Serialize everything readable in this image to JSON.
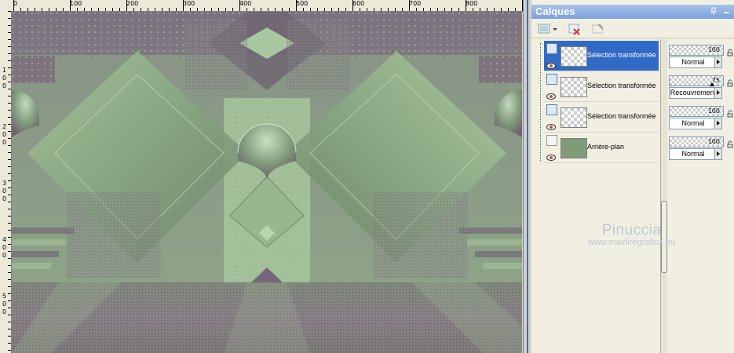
{
  "ruler": {
    "top_labels": [
      "0",
      "100",
      "200",
      "300",
      "400",
      "500",
      "600",
      "700",
      "800"
    ],
    "left_labels": [
      "1",
      "0",
      "0",
      "2",
      "0",
      "0",
      "3",
      "0",
      "0",
      "4",
      "0",
      "0",
      "5",
      "0",
      "0"
    ]
  },
  "panel": {
    "title": "Calques",
    "pin_icon": "pin-icon",
    "minimize_icon": "minimize-icon"
  },
  "toolbar": {
    "tools": [
      "new-layer-icon",
      "delete-layer-icon",
      "mask-icon"
    ]
  },
  "layers": [
    {
      "name": "Sélection transformée",
      "selected": true,
      "opacity": "100",
      "blend": "Normal"
    },
    {
      "name": "Sélection transformée",
      "selected": false,
      "opacity": "75",
      "blend": "Recouvrement"
    },
    {
      "name": "Sélection transformée",
      "selected": false,
      "opacity": "100",
      "blend": "Normal"
    },
    {
      "name": "Arrière-plan",
      "selected": false,
      "opacity": "100",
      "blend": "Normal"
    }
  ],
  "watermark": {
    "line1": "Pinuccia",
    "line2": "www.maidiregrafica.eu"
  },
  "colors": {
    "accent": "#316ac5",
    "canvas_green": "#8fb08a",
    "canvas_mauve": "#7d6a78"
  }
}
